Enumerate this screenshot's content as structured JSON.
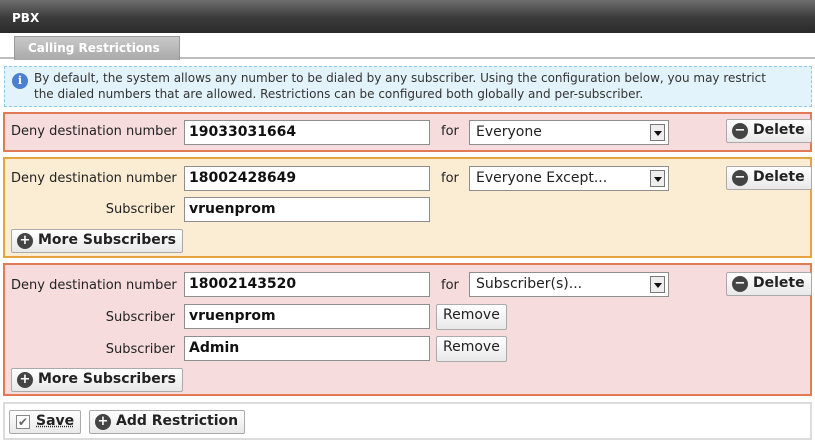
{
  "window": {
    "title": "PBX"
  },
  "tabs": [
    {
      "label": "Calling Restrictions",
      "active": true
    }
  ],
  "info": {
    "icon": "info-icon",
    "line1": "By default, the system allows any number to be dialed by any subscriber. Using the configuration below, you may restrict",
    "line2": "the dialed numbers that are allowed. Restrictions can be configured both globally and per-subscriber."
  },
  "labels": {
    "deny": "Deny destination number",
    "for": "for",
    "subscriber": "Subscriber",
    "delete": "Delete",
    "remove": "Remove",
    "more_subscribers": "More Subscribers"
  },
  "restrictions": [
    {
      "number": "19033031664",
      "scope": "Everyone",
      "subscribers": []
    },
    {
      "number": "18002428649",
      "scope": "Everyone Except...",
      "subscribers": [
        "vruenprom"
      ]
    },
    {
      "number": "18002143520",
      "scope": "Subscriber(s)...",
      "subscribers": [
        "vruenprom",
        "Admin"
      ]
    }
  ],
  "footer": {
    "save": "Save",
    "add": "Add Restriction"
  },
  "colors": {
    "rule_red_border": "#e07b56",
    "rule_red_bg": "#f6dcdc",
    "rule_orange_border": "#e4a440",
    "rule_orange_bg": "#fbecd4"
  }
}
